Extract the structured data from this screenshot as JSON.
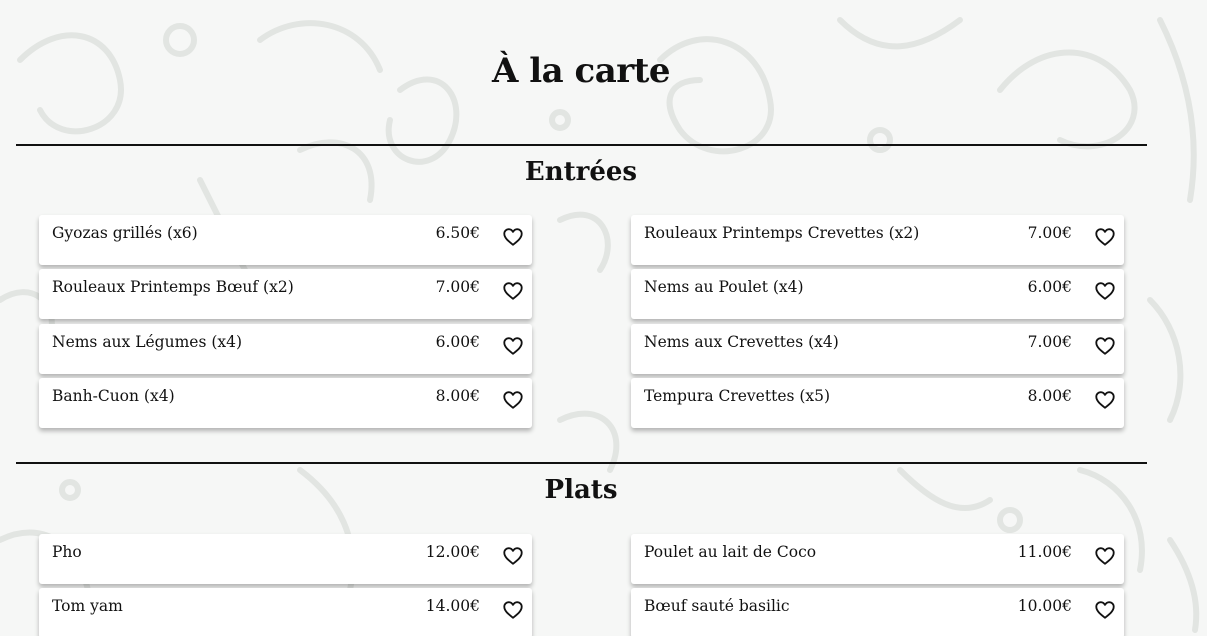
{
  "page": {
    "title": "À la carte"
  },
  "sections": [
    {
      "title": "Entrées",
      "items": [
        {
          "name": "Gyozas grillés (x6)",
          "price": "6.50€"
        },
        {
          "name": "Rouleaux Printemps Crevettes (x2)",
          "price": "7.00€"
        },
        {
          "name": "Rouleaux Printemps Bœuf (x2)",
          "price": "7.00€"
        },
        {
          "name": "Nems au Poulet (x4)",
          "price": "6.00€"
        },
        {
          "name": "Nems aux Légumes (x4)",
          "price": "6.00€"
        },
        {
          "name": "Nems aux Crevettes (x4)",
          "price": "7.00€"
        },
        {
          "name": "Banh-Cuon (x4)",
          "price": "8.00€"
        },
        {
          "name": "Tempura Crevettes (x5)",
          "price": "8.00€"
        }
      ]
    },
    {
      "title": "Plats",
      "items": [
        {
          "name": "Pho",
          "price": "12.00€"
        },
        {
          "name": "Poulet au lait de Coco",
          "price": "11.00€"
        },
        {
          "name": "Tom yam",
          "price": "14.00€"
        },
        {
          "name": "Bœuf sauté basilic",
          "price": "10.00€"
        }
      ]
    }
  ],
  "icons": {
    "favorite": "heart-outline-icon"
  },
  "colors": {
    "text": "#111111",
    "card": "#ffffff",
    "background": "#f6f7f6",
    "rule": "#111111"
  }
}
